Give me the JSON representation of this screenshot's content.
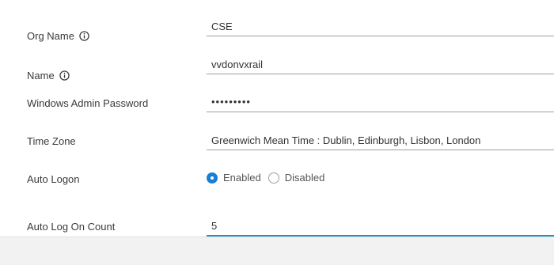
{
  "form": {
    "org_name": {
      "label": "Org Name",
      "value": "CSE"
    },
    "name": {
      "label": "Name",
      "value": "vvdonvxrail"
    },
    "windows_admin_password": {
      "label": "Windows Admin Password",
      "value": "•••••••••"
    },
    "time_zone": {
      "label": "Time Zone",
      "value": "Greenwich Mean Time : Dublin, Edinburgh, Lisbon, London"
    },
    "auto_logon": {
      "label": "Auto Logon",
      "options": [
        "Enabled",
        "Disabled"
      ],
      "selected": "Enabled"
    },
    "auto_log_on_count": {
      "label": "Auto Log On Count",
      "value": "5"
    }
  },
  "colors": {
    "accent": "#1a7fd4",
    "active_underline": "#2b8ec6",
    "field_underline": "#9aa0a6"
  },
  "icons": {
    "info": "info-circle-icon"
  }
}
